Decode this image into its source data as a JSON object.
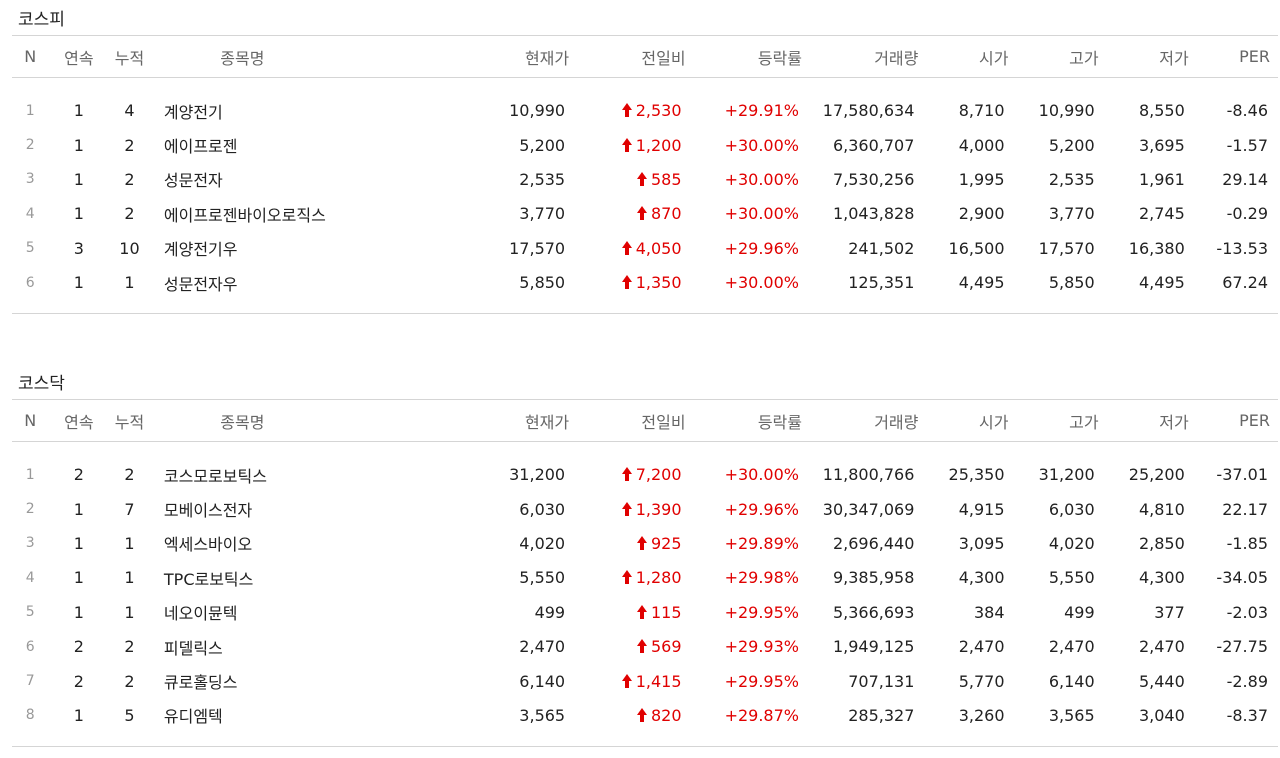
{
  "colors": {
    "up": "#e00000",
    "header_text": "#666666",
    "border": "#d5d5d5"
  },
  "headers": {
    "n": "N",
    "consecutive": "연속",
    "cumulative": "누적",
    "name": "종목명",
    "price": "현재가",
    "change": "전일비",
    "rate": "등락률",
    "volume": "거래량",
    "open": "시가",
    "high": "고가",
    "low": "저가",
    "per": "PER"
  },
  "kospi": {
    "title": "코스피",
    "rows": [
      {
        "n": "1",
        "consecutive": "1",
        "cumulative": "4",
        "name": "계양전기",
        "price": "10,990",
        "change": "2,530",
        "rate": "+29.91%",
        "volume": "17,580,634",
        "open": "8,710",
        "high": "10,990",
        "low": "8,550",
        "per": "-8.46"
      },
      {
        "n": "2",
        "consecutive": "1",
        "cumulative": "2",
        "name": "에이프로젠",
        "price": "5,200",
        "change": "1,200",
        "rate": "+30.00%",
        "volume": "6,360,707",
        "open": "4,000",
        "high": "5,200",
        "low": "3,695",
        "per": "-1.57"
      },
      {
        "n": "3",
        "consecutive": "1",
        "cumulative": "2",
        "name": "성문전자",
        "price": "2,535",
        "change": "585",
        "rate": "+30.00%",
        "volume": "7,530,256",
        "open": "1,995",
        "high": "2,535",
        "low": "1,961",
        "per": "29.14"
      },
      {
        "n": "4",
        "consecutive": "1",
        "cumulative": "2",
        "name": "에이프로젠바이오로직스",
        "price": "3,770",
        "change": "870",
        "rate": "+30.00%",
        "volume": "1,043,828",
        "open": "2,900",
        "high": "3,770",
        "low": "2,745",
        "per": "-0.29"
      },
      {
        "n": "5",
        "consecutive": "3",
        "cumulative": "10",
        "name": "계양전기우",
        "price": "17,570",
        "change": "4,050",
        "rate": "+29.96%",
        "volume": "241,502",
        "open": "16,500",
        "high": "17,570",
        "low": "16,380",
        "per": "-13.53"
      },
      {
        "n": "6",
        "consecutive": "1",
        "cumulative": "1",
        "name": "성문전자우",
        "price": "5,850",
        "change": "1,350",
        "rate": "+30.00%",
        "volume": "125,351",
        "open": "4,495",
        "high": "5,850",
        "low": "4,495",
        "per": "67.24"
      }
    ]
  },
  "kosdaq": {
    "title": "코스닥",
    "rows": [
      {
        "n": "1",
        "consecutive": "2",
        "cumulative": "2",
        "name": "코스모로보틱스",
        "price": "31,200",
        "change": "7,200",
        "rate": "+30.00%",
        "volume": "11,800,766",
        "open": "25,350",
        "high": "31,200",
        "low": "25,200",
        "per": "-37.01"
      },
      {
        "n": "2",
        "consecutive": "1",
        "cumulative": "7",
        "name": "모베이스전자",
        "price": "6,030",
        "change": "1,390",
        "rate": "+29.96%",
        "volume": "30,347,069",
        "open": "4,915",
        "high": "6,030",
        "low": "4,810",
        "per": "22.17"
      },
      {
        "n": "3",
        "consecutive": "1",
        "cumulative": "1",
        "name": "엑세스바이오",
        "price": "4,020",
        "change": "925",
        "rate": "+29.89%",
        "volume": "2,696,440",
        "open": "3,095",
        "high": "4,020",
        "low": "2,850",
        "per": "-1.85"
      },
      {
        "n": "4",
        "consecutive": "1",
        "cumulative": "1",
        "name": "TPC로보틱스",
        "price": "5,550",
        "change": "1,280",
        "rate": "+29.98%",
        "volume": "9,385,958",
        "open": "4,300",
        "high": "5,550",
        "low": "4,300",
        "per": "-34.05"
      },
      {
        "n": "5",
        "consecutive": "1",
        "cumulative": "1",
        "name": "네오이뮨텍",
        "price": "499",
        "change": "115",
        "rate": "+29.95%",
        "volume": "5,366,693",
        "open": "384",
        "high": "499",
        "low": "377",
        "per": "-2.03"
      },
      {
        "n": "6",
        "consecutive": "2",
        "cumulative": "2",
        "name": "피델릭스",
        "price": "2,470",
        "change": "569",
        "rate": "+29.93%",
        "volume": "1,949,125",
        "open": "2,470",
        "high": "2,470",
        "low": "2,470",
        "per": "-27.75"
      },
      {
        "n": "7",
        "consecutive": "2",
        "cumulative": "2",
        "name": "큐로홀딩스",
        "price": "6,140",
        "change": "1,415",
        "rate": "+29.95%",
        "volume": "707,131",
        "open": "5,770",
        "high": "6,140",
        "low": "5,440",
        "per": "-2.89"
      },
      {
        "n": "8",
        "consecutive": "1",
        "cumulative": "5",
        "name": "유디엠텍",
        "price": "3,565",
        "change": "820",
        "rate": "+29.87%",
        "volume": "285,327",
        "open": "3,260",
        "high": "3,565",
        "low": "3,040",
        "per": "-8.37"
      }
    ]
  }
}
